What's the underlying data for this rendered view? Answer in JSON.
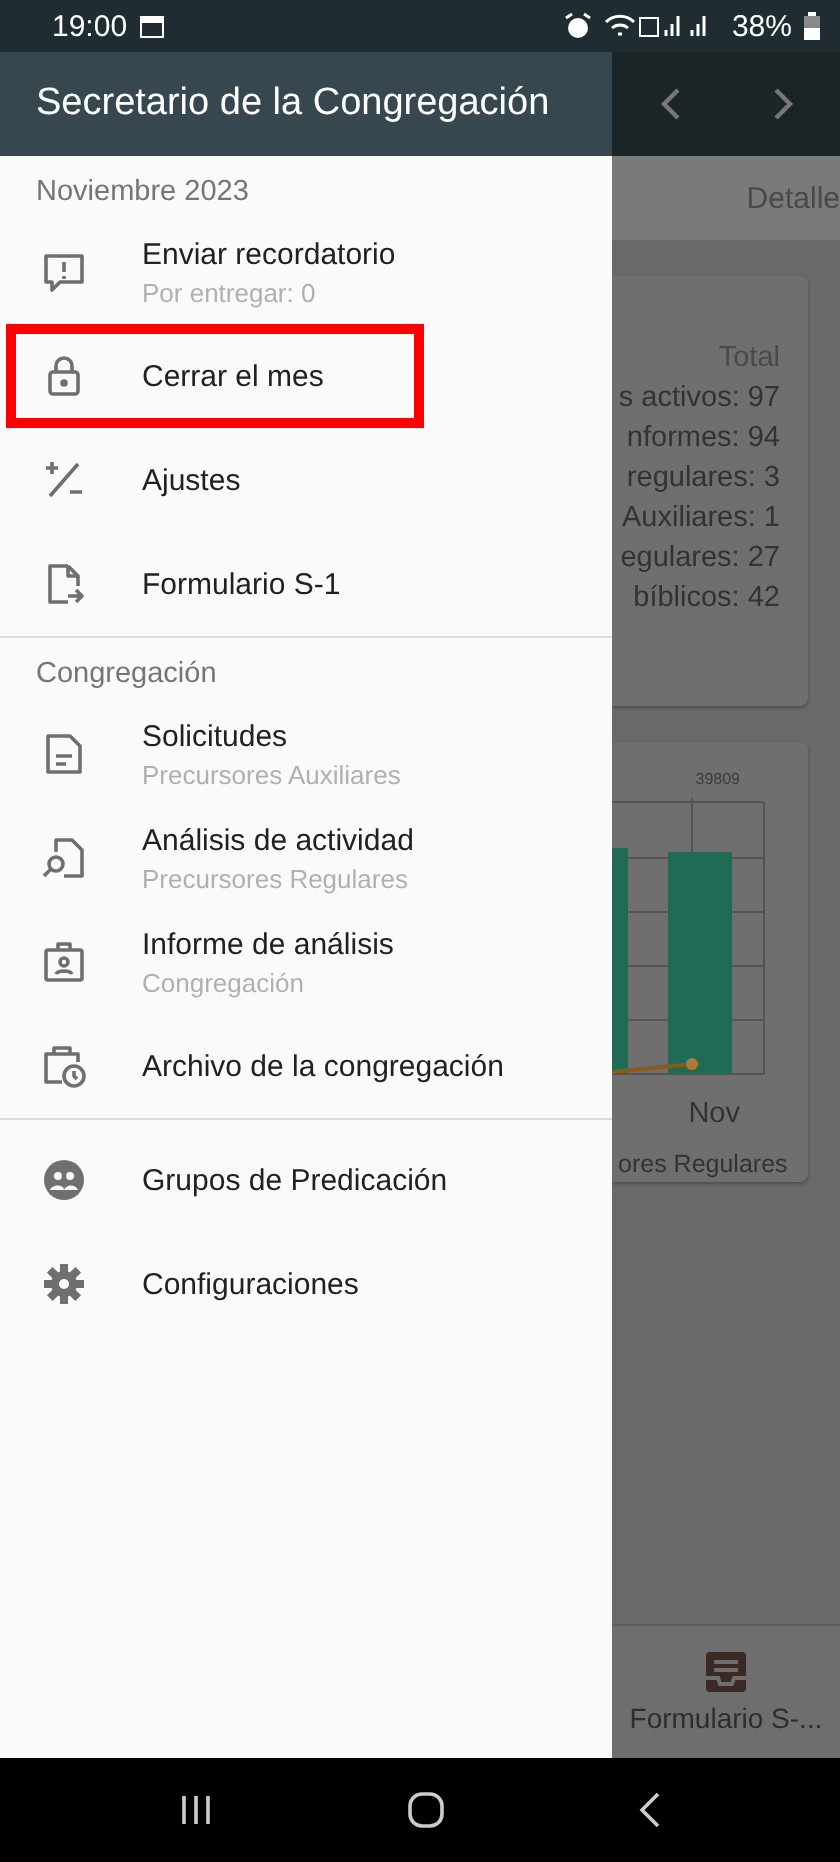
{
  "status_bar": {
    "time": "19:00",
    "battery": "38%"
  },
  "drawer": {
    "title": "Secretario de la Congregación",
    "sections": [
      {
        "title": "Noviembre 2023",
        "items": [
          {
            "kind": "alert-message",
            "label": "Enviar recordatorio",
            "subtitle": "Por entregar: 0",
            "highlighted": false
          },
          {
            "kind": "lock",
            "label": "Cerrar el mes",
            "highlighted": true
          },
          {
            "kind": "plus-minus",
            "label": "Ajustes",
            "highlighted": false
          },
          {
            "kind": "file-export",
            "label": "Formulario S-1",
            "highlighted": false
          }
        ]
      },
      {
        "title": "Congregación",
        "items": [
          {
            "kind": "document",
            "label": "Solicitudes",
            "subtitle": "Precursores Auxiliares",
            "highlighted": false
          },
          {
            "kind": "search-document",
            "label": "Análisis de actividad",
            "subtitle": "Precursores Regulares",
            "highlighted": false
          },
          {
            "kind": "id-badge",
            "label": "Informe de análisis",
            "subtitle": "Congregación",
            "highlighted": false
          },
          {
            "kind": "calendar-clock",
            "label": "Archivo de la congregación",
            "highlighted": false
          }
        ]
      },
      {
        "items": [
          {
            "kind": "groups",
            "label": "Grupos de Predicación",
            "highlighted": false
          },
          {
            "kind": "gear",
            "label": "Configuraciones",
            "highlighted": false
          }
        ]
      }
    ]
  },
  "background": {
    "tab": "Detalle",
    "summary": {
      "heading": "Total",
      "lines": [
        "s activos: 97",
        "nformes: 94",
        "regulares: 3",
        "Auxiliares: 1",
        "egulares: 27",
        "bíblicos: 42"
      ]
    },
    "chart": {
      "bar_label": "39809",
      "category": "Nov",
      "caption": "ores Regulares"
    },
    "bottom_nav": {
      "label": "Formulario S-..."
    }
  }
}
